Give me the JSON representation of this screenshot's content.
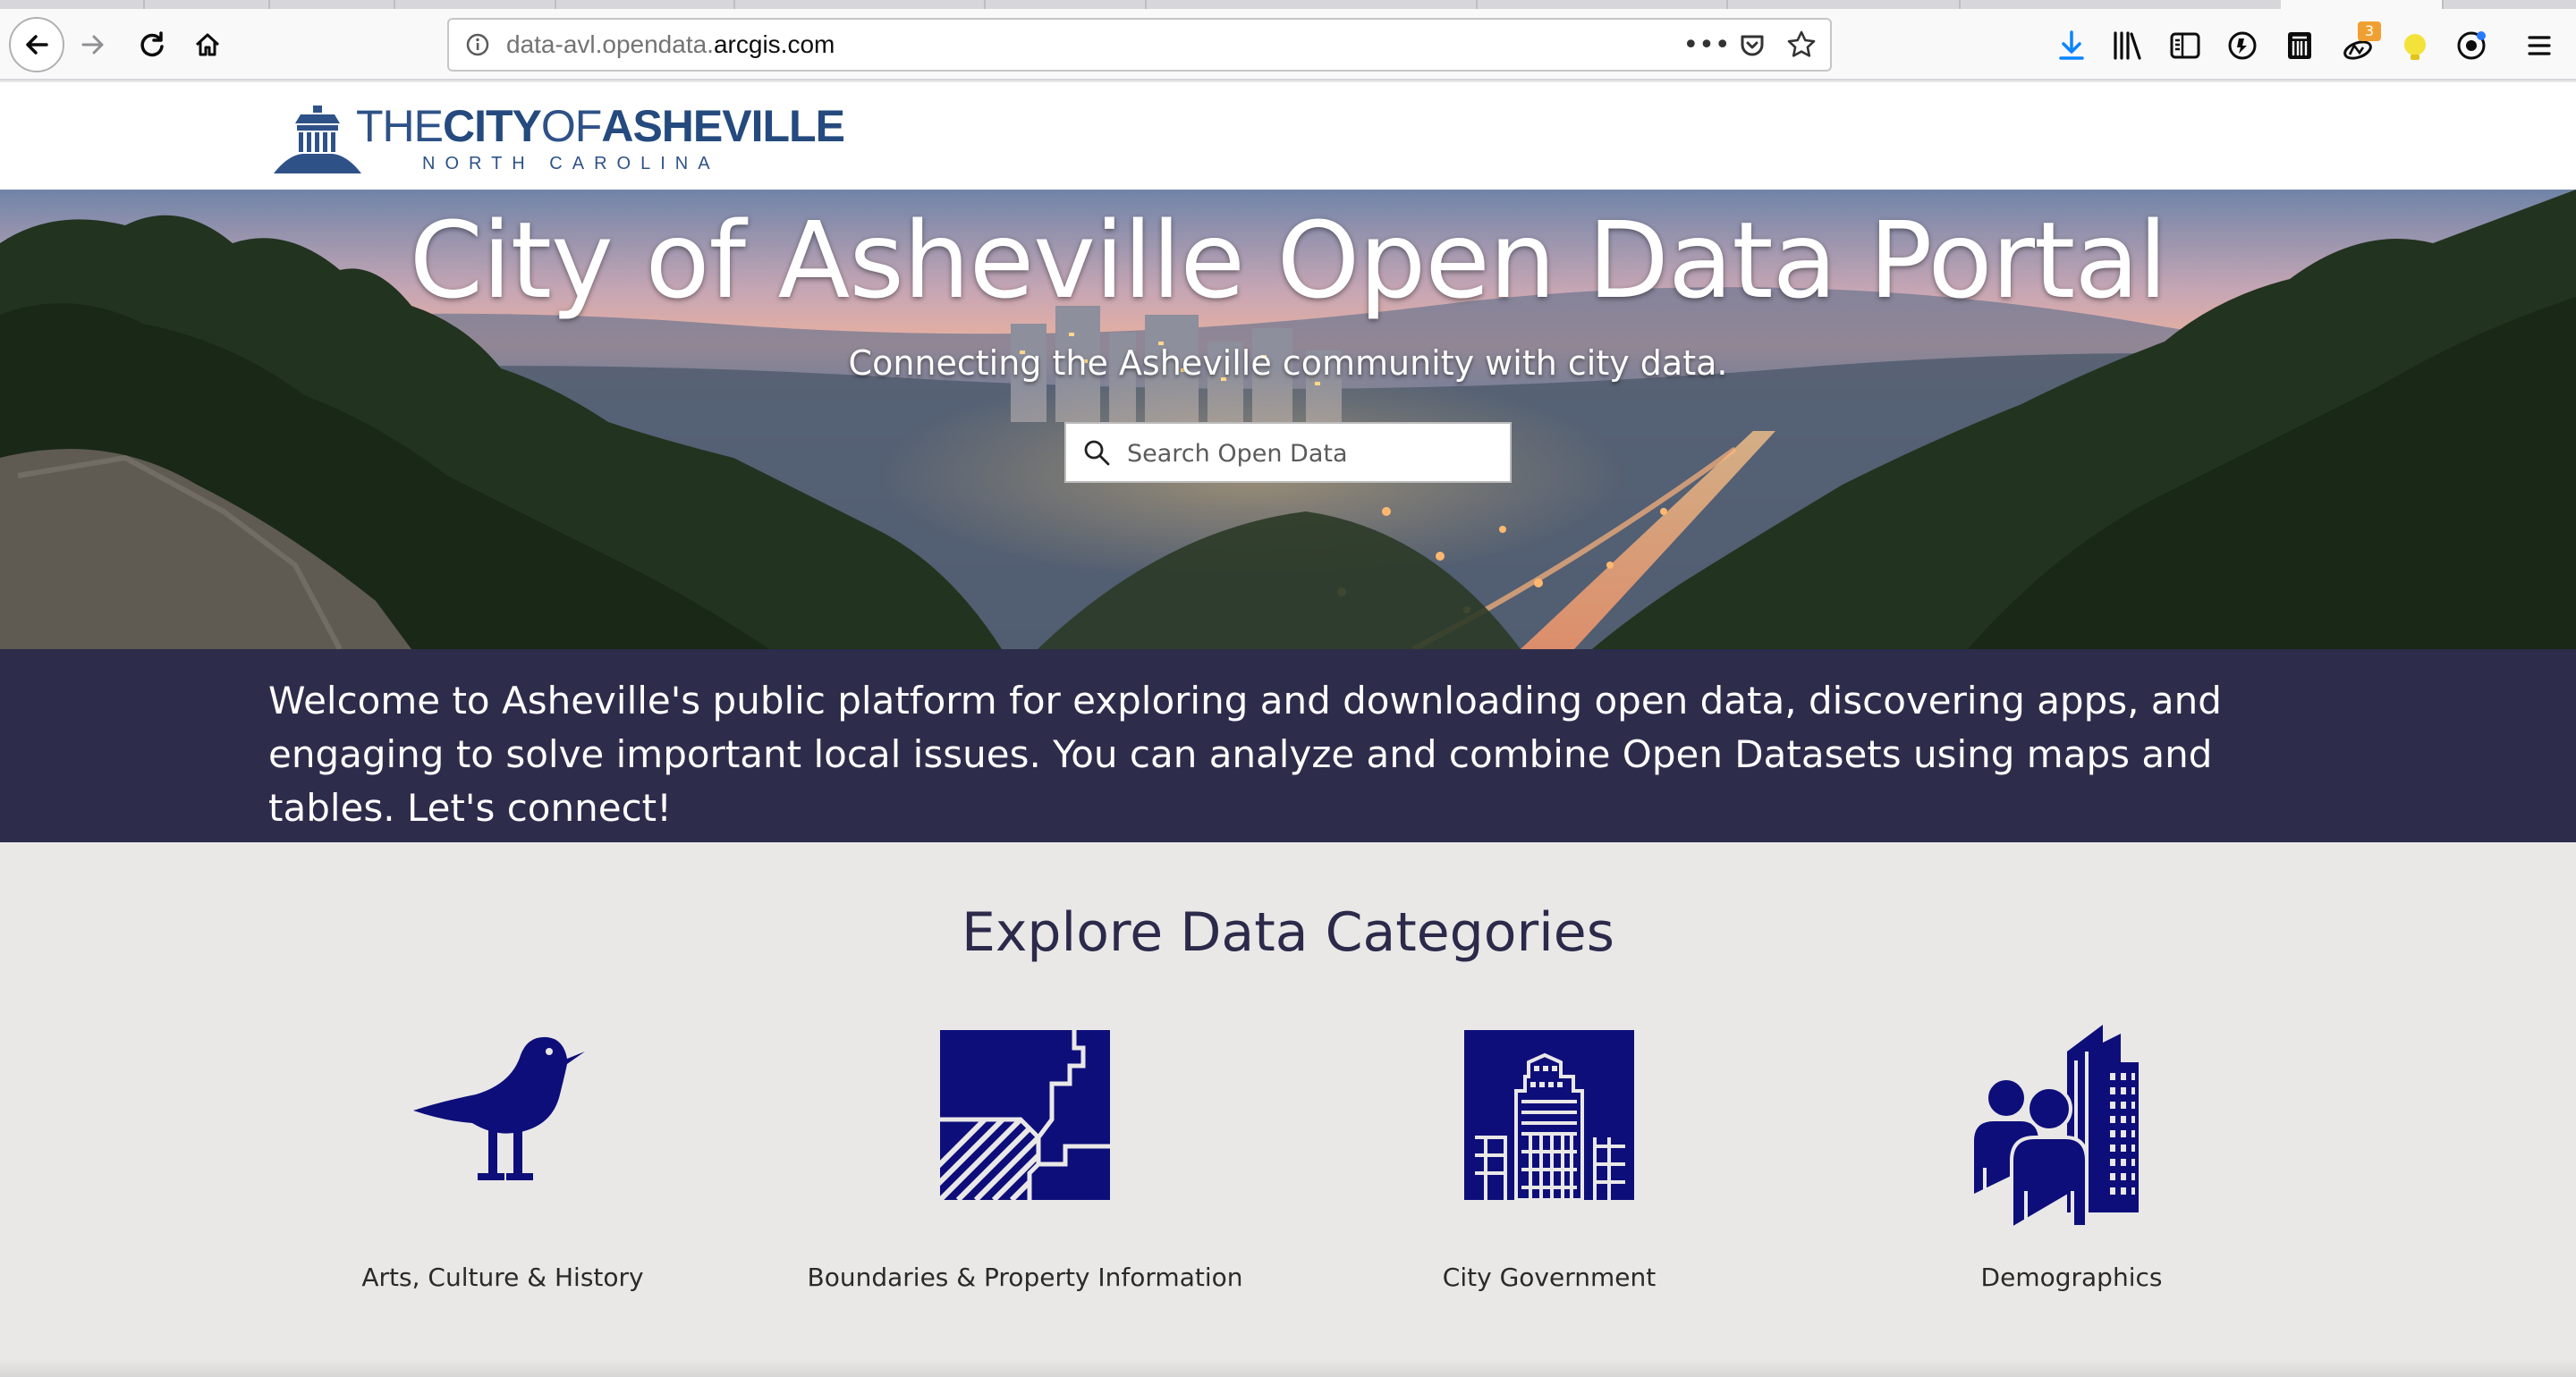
{
  "browser": {
    "url_prefix": "data-avl.opendata.",
    "url_domain": "arcgis.com",
    "page_actions_label": "•••",
    "extension_badge_count": "3",
    "icons": [
      "back-icon",
      "forward-icon",
      "reload-icon",
      "home-icon",
      "site-info-icon",
      "page-actions-icon",
      "pocket-icon",
      "bookmark-star-icon",
      "download-icon",
      "library-icon",
      "sidebar-icon",
      "extension-icon",
      "extension-icon",
      "extension-icon",
      "extension-icon",
      "extension-icon",
      "menu-icon"
    ]
  },
  "header": {
    "logo_the": "THE",
    "logo_city": "CITY",
    "logo_of": "OF",
    "logo_name": "ASHEVILLE",
    "logo_state": "NORTH CAROLINA"
  },
  "hero": {
    "title": "City of Asheville Open Data Portal",
    "subtitle": "Connecting the Asheville community with city data.",
    "search_placeholder": "Search Open Data"
  },
  "welcome": {
    "text": "Welcome to Asheville's public platform for exploring and downloading open data, discovering apps, and engaging to solve important local issues. You can analyze and combine Open Datasets using maps and tables. Let's connect!"
  },
  "categories": {
    "title": "Explore Data Categories",
    "items": [
      {
        "label": "Arts, Culture & History",
        "icon": "bird-icon"
      },
      {
        "label": "Boundaries & Property Information",
        "icon": "parcel-map-icon"
      },
      {
        "label": "City Government",
        "icon": "city-building-icon"
      },
      {
        "label": "Demographics",
        "icon": "people-buildings-icon"
      }
    ]
  },
  "colors": {
    "brand_navy": "#2e2c4b",
    "icon_navy": "#0e0e7a",
    "logo_blue": "#2e5288"
  }
}
